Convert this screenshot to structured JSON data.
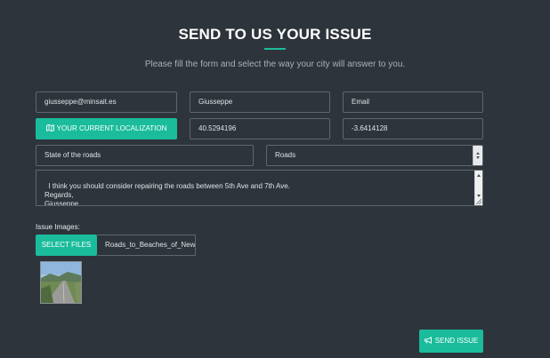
{
  "header": {
    "title": "SEND TO US YOUR ISSUE",
    "subtitle": "Please fill the form and select the way your city will answer to you."
  },
  "form": {
    "email_value": "giusseppe@minsait.es",
    "name_value": "Giusseppe",
    "contact_method_value": "Email",
    "localization_button": "YOUR CURRENT LOCALIZATION",
    "latitude_value": "40.5294196",
    "longitude_value": "-3.6414128",
    "subject_value": "State of the roads",
    "category_selected": "Roads",
    "message_value": "I think you should consider repairing the roads between 5th Ave and 7th Ave.\nRegards,\nGiusseppe."
  },
  "images": {
    "label": "Issue Images:",
    "select_files_button": "SELECT FILES",
    "file_name": "Roads_to_Beaches_of_New"
  },
  "actions": {
    "send_button": "SEND ISSUE"
  },
  "icons": {
    "localization": "map-icon",
    "send": "megaphone-icon"
  },
  "colors": {
    "background": "#2e343b",
    "accent": "#1abc9c"
  }
}
